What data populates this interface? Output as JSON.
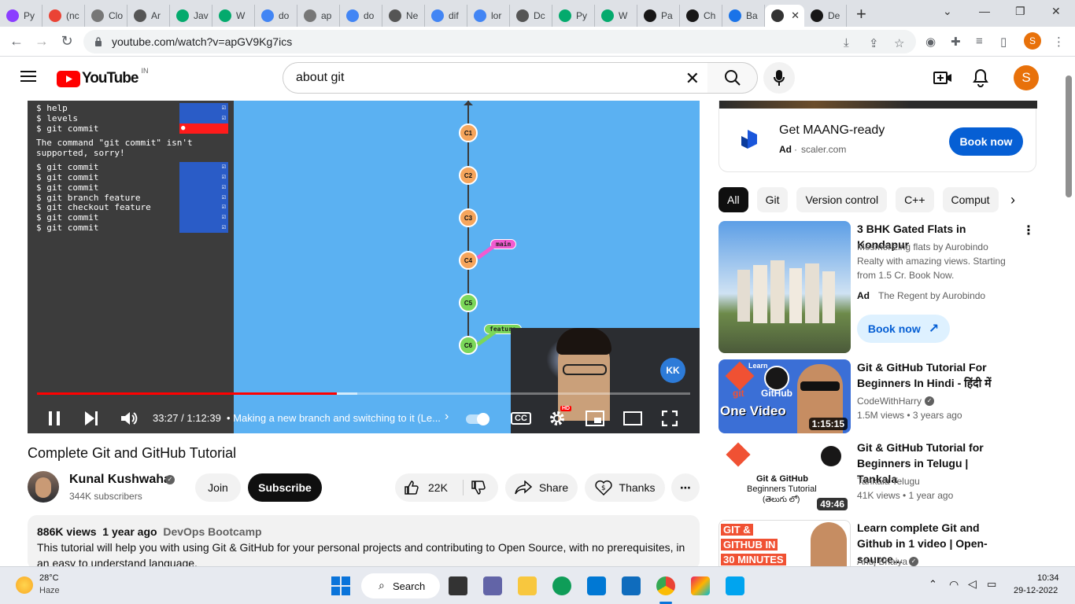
{
  "browser": {
    "tabs": [
      {
        "label": "Py",
        "icon": "generic-icon",
        "color": "#8b3dff"
      },
      {
        "label": "(nc",
        "icon": "gmail-icon",
        "color": "#ea4335"
      },
      {
        "label": "Clo",
        "icon": "generic-icon",
        "color": "#777777"
      },
      {
        "label": "Ar",
        "icon": "globe-icon",
        "color": "#555555"
      },
      {
        "label": "Jav",
        "icon": "w3-icon",
        "color": "#04aa6d"
      },
      {
        "label": "W",
        "icon": "w3-icon",
        "color": "#04aa6d"
      },
      {
        "label": "do",
        "icon": "google-icon",
        "color": "#4285f4"
      },
      {
        "label": "ap",
        "icon": "generic-icon",
        "color": "#777777"
      },
      {
        "label": "do",
        "icon": "google-icon",
        "color": "#4285f4"
      },
      {
        "label": "Ne",
        "icon": "globe-icon",
        "color": "#555555"
      },
      {
        "label": "dif",
        "icon": "google-icon",
        "color": "#4285f4"
      },
      {
        "label": "lor",
        "icon": "google-icon",
        "color": "#4285f4"
      },
      {
        "label": "Dc",
        "icon": "globe-icon",
        "color": "#555555"
      },
      {
        "label": "Py",
        "icon": "w3-icon",
        "color": "#04aa6d"
      },
      {
        "label": "W",
        "icon": "w3-icon",
        "color": "#04aa6d"
      },
      {
        "label": "Pa",
        "icon": "github-icon",
        "color": "#181717"
      },
      {
        "label": "Ch",
        "icon": "github-icon",
        "color": "#181717"
      },
      {
        "label": "Ba",
        "icon": "generic-icon",
        "color": "#1a73e8"
      },
      {
        "label": "",
        "icon": "speaker-icon",
        "color": "#333333",
        "active": true
      },
      {
        "label": "De",
        "icon": "github-icon",
        "color": "#181717"
      }
    ],
    "new_tab": "+",
    "url": "youtube.com/watch?v=apGV9Kg7ics",
    "profile_initial": "S"
  },
  "youtube": {
    "logo_text": "YouTube",
    "region": "IN",
    "search_value": "about git",
    "avatar_initial": "S"
  },
  "player": {
    "terminal_lines": [
      {
        "text": "$ help",
        "box": "check"
      },
      {
        "text": "$ levels",
        "box": "check"
      },
      {
        "text": "$ git commit",
        "box": "error"
      },
      {
        "text": "The command \"git commit\" isn't",
        "box": ""
      },
      {
        "text": "supported, sorry!",
        "box": ""
      },
      {
        "text": "$ git commit",
        "box": "check"
      },
      {
        "text": "$ git commit",
        "box": "check"
      },
      {
        "text": "$ git commit",
        "box": "check"
      },
      {
        "text": "$ git branch feature",
        "box": "check"
      },
      {
        "text": "$ git checkout feature",
        "box": "check"
      },
      {
        "text": "$ git commit",
        "box": "check"
      },
      {
        "text": "$ git commit",
        "box": "check"
      }
    ],
    "nodes": [
      {
        "label": "C1",
        "color": "#f5a55c"
      },
      {
        "label": "C2",
        "color": "#f5a55c"
      },
      {
        "label": "C3",
        "color": "#f5a55c"
      },
      {
        "label": "C4",
        "color": "#f5a55c"
      },
      {
        "label": "C5",
        "color": "#7bd75a"
      },
      {
        "label": "C6",
        "color": "#7bd75a"
      }
    ],
    "branch_main": "main",
    "branch_feature": "feature",
    "watermark": "KK",
    "progress": 0.459,
    "buffered": 0.49,
    "time_current": "33:27",
    "time_separator": "/",
    "time_total": "1:12:39",
    "chapter_title": "• Making a new branch and switching to it (Le...",
    "hd_badge": "HD",
    "cc_label": "CC"
  },
  "video": {
    "title": "Complete Git and GitHub Tutorial",
    "channel_name": "Kunal Kushwaha",
    "subscribers": "344K subscribers",
    "join_label": "Join",
    "subscribe_label": "Subscribe",
    "likes": "22K",
    "share_label": "Share",
    "thanks_label": "Thanks",
    "more_label": "⋯",
    "views": "886K views",
    "age": "1 year ago",
    "tag": "DevOps Bootcamp",
    "description": "This tutorial will help you with using Git & GitHub for your personal projects and contributing to Open Source, with no prerequisites, in an easy to understand language."
  },
  "sidebar": {
    "ad": {
      "title": "Get MAANG-ready",
      "badge": "Ad",
      "sep": "·",
      "domain": "scaler.com",
      "cta": "Book now"
    },
    "chips": [
      "All",
      "Git",
      "Version control",
      "C++",
      "Comput"
    ],
    "recs": [
      {
        "title": "3 BHK Gated Flats in Kondapur",
        "desc": "Mesmerizing flats by Aurobindo Realty with amazing views. Starting from 1.5 Cr. Book Now.",
        "badge": "Ad",
        "advertiser": "The Regent by Aurobindo",
        "cta": "Book now"
      },
      {
        "title": "Git & GitHub Tutorial For Beginners In Hindi - हिंदी में",
        "channel": "CodeWithHarry",
        "meta": "1.5M views  • 3 years ago",
        "duration": "1:15:15",
        "thumb_text_top": "Learn",
        "thumb_text_a": "git",
        "thumb_text_b": "GitHub",
        "thumb_text_c": "One Video"
      },
      {
        "title": "Git & GitHub Tutorial for Beginners in Telugu | Tankala",
        "channel": "Tankala Telugu",
        "meta": "41K views  • 1 year ago",
        "duration": "49:46",
        "thumb_text_a": "Git & GitHub",
        "thumb_text_b": "Beginners Tutorial",
        "thumb_text_c": "(తెలుగు లో)"
      },
      {
        "title": "Learn complete Git and Github in 1 video | Open-source...",
        "channel": "Anuj Bhaiya",
        "thumb_text_a": "GIT &",
        "thumb_text_b": "GITHUB IN",
        "thumb_text_c": "30 MINUTES"
      }
    ]
  },
  "taskbar": {
    "temp": "28°C",
    "weather": "Haze",
    "search_label": "Search",
    "time": "10:34",
    "date": "29-12-2022"
  }
}
